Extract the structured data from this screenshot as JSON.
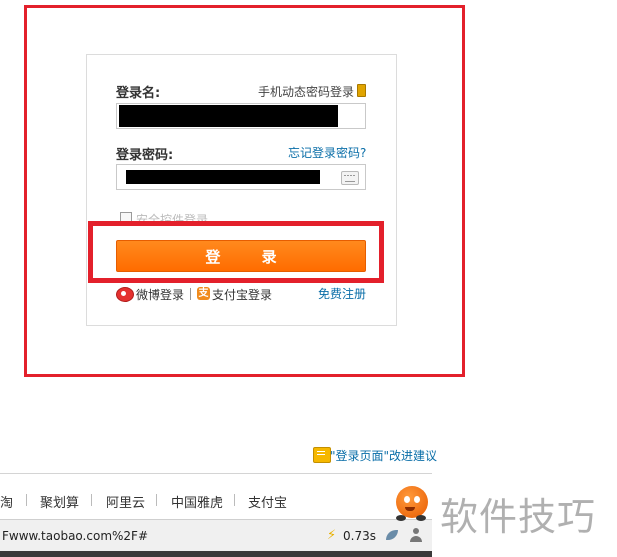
{
  "login": {
    "username_label": "登录名:",
    "phone_login": "手机动态密码登录",
    "password_label": "登录密码:",
    "forgot_password": "忘记登录密码?",
    "security_control": "安全控件登录",
    "login_button": "登 录",
    "weibo_login": "微博登录",
    "alipay_login": "支付宝登录",
    "register": "免费注册"
  },
  "feedback": {
    "label": "\"登录页面\"改进建议"
  },
  "nav": {
    "items": [
      "淘",
      "聚划算",
      "阿里云",
      "中国雅虎",
      "支付宝"
    ]
  },
  "status": {
    "url": "Fwww.taobao.com%2F#",
    "load_time": "0.73s"
  },
  "watermark": "软件技巧",
  "colors": {
    "accent": "#ff6c00",
    "annotation": "#e3202b",
    "link": "#0a6ea8"
  }
}
